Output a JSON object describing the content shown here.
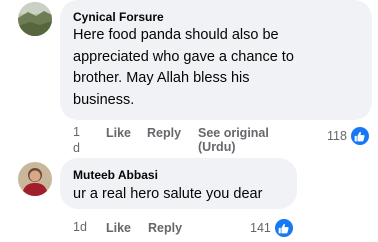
{
  "comments": [
    {
      "author": "Cynical Forsure",
      "lines": [
        "Here food panda should also be",
        "appreciated who gave a chance to",
        "brother. May Allah bless his",
        "business."
      ],
      "time_line1": "1",
      "time_line2": "d",
      "like_label": "Like",
      "reply_label": "Reply",
      "see_original_line1": "See original",
      "see_original_line2": "(Urdu)",
      "reaction_count": "118",
      "reaction_icon": "like-icon"
    },
    {
      "author": "Muteeb Abbasi",
      "lines": [
        "ur a real hero salute you dear"
      ],
      "time": "1d",
      "like_label": "Like",
      "reply_label": "Reply",
      "reaction_count": "141",
      "reaction_icon": "like-icon"
    }
  ],
  "colors": {
    "bubble": "#f0f2f5",
    "text": "#050505",
    "secondary": "#65676b",
    "like_blue": "#1877f2"
  }
}
